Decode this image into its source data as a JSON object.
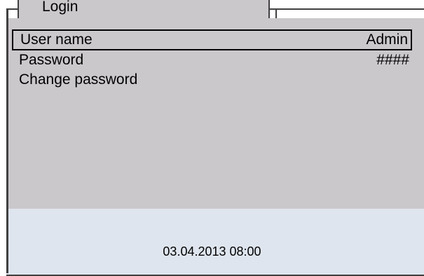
{
  "tab": {
    "title": "Login"
  },
  "menu": {
    "items": [
      {
        "label": "User name",
        "value": "Admin",
        "selected": true
      },
      {
        "label": "Password",
        "value": "####"
      },
      {
        "label": "Change password",
        "value": ""
      }
    ]
  },
  "status": {
    "datetime": "03.04.2013 08:00"
  },
  "colors": {
    "panel": "#cbc8cc",
    "status_area": "#dfe5ee",
    "frame": "#404040"
  }
}
